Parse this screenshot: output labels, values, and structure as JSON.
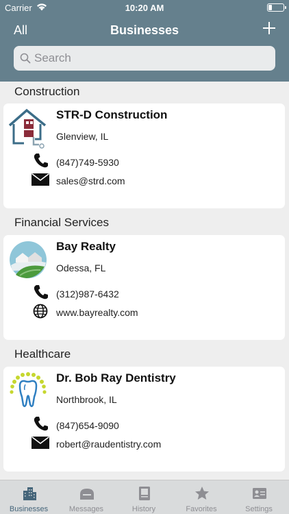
{
  "status_bar": {
    "carrier": "Carrier",
    "time": "10:20 AM"
  },
  "nav": {
    "left": "All",
    "title": "Businesses"
  },
  "search": {
    "placeholder": "Search"
  },
  "sections": [
    {
      "title": "Construction",
      "business": {
        "name": "STR-D Construction",
        "location": "Glenview, IL",
        "phone": "(847)749-5930",
        "email": "sales@strd.com"
      }
    },
    {
      "title": "Financial Services",
      "business": {
        "name": "Bay Realty",
        "location": "Odessa, FL",
        "phone": "(312)987-6432",
        "website": "www.bayrealty.com"
      }
    },
    {
      "title": "Healthcare",
      "business": {
        "name": "Dr. Bob Ray Dentistry",
        "location": "Northbrook, IL",
        "phone": "(847)654-9090",
        "email": "robert@raudentistry.com"
      }
    }
  ],
  "tabs": [
    {
      "label": "Businesses",
      "icon": "building-icon",
      "active": true
    },
    {
      "label": "Messages",
      "icon": "message-icon"
    },
    {
      "label": "History",
      "icon": "history-icon"
    },
    {
      "label": "Favorites",
      "icon": "star-icon"
    },
    {
      "label": "Settings",
      "icon": "settings-icon"
    }
  ],
  "colors": {
    "nav": "#65808d",
    "active_tab": "#45657a",
    "inactive_tab": "#8e8e93"
  }
}
